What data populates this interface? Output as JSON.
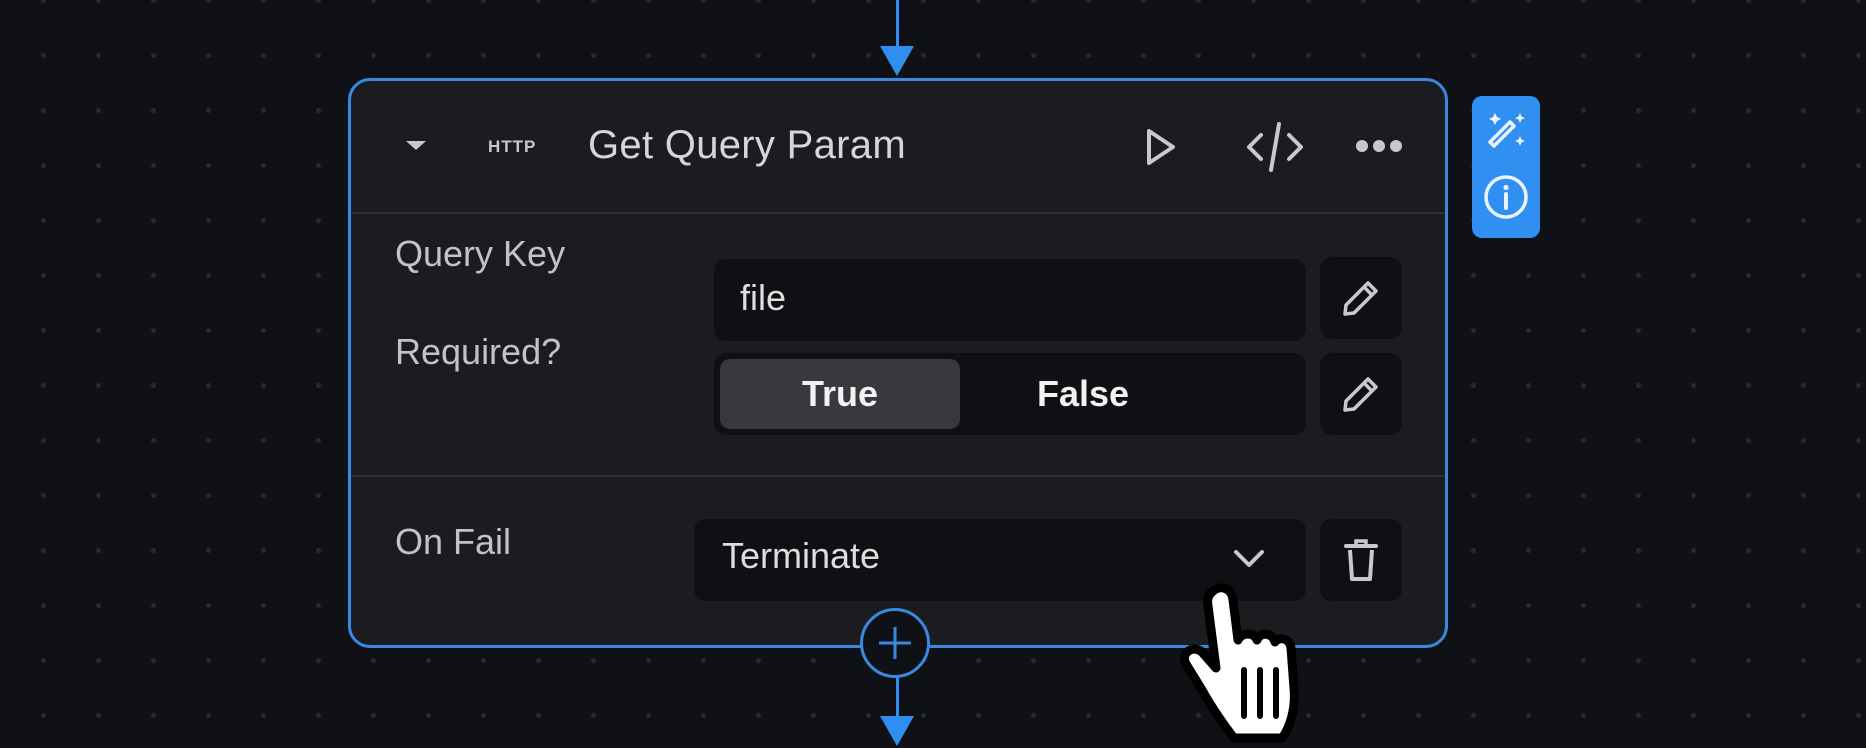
{
  "canvas": {
    "background_color": "#101116",
    "connector_color": "#2f8ff0"
  },
  "node": {
    "type_tag": "HTTP",
    "title": "Get Query Param",
    "header_actions": [
      {
        "name": "run",
        "icon": "play-icon"
      },
      {
        "name": "code",
        "icon": "code-icon"
      },
      {
        "name": "more",
        "icon": "more-horizontal-icon"
      }
    ],
    "fields": {
      "query_key": {
        "label": "Query Key",
        "value": "file"
      },
      "required": {
        "label": "Required?",
        "options": [
          "True",
          "False"
        ],
        "selected": "True"
      }
    },
    "on_fail": {
      "label": "On Fail",
      "value": "Terminate"
    },
    "border_color": "#3a88e0"
  },
  "side_panel": {
    "color": "#2f90f2",
    "items": [
      {
        "name": "magic",
        "icon": "magic-wand-icon"
      },
      {
        "name": "info",
        "icon": "info-icon"
      }
    ]
  },
  "add_step": {
    "icon": "plus-icon"
  }
}
